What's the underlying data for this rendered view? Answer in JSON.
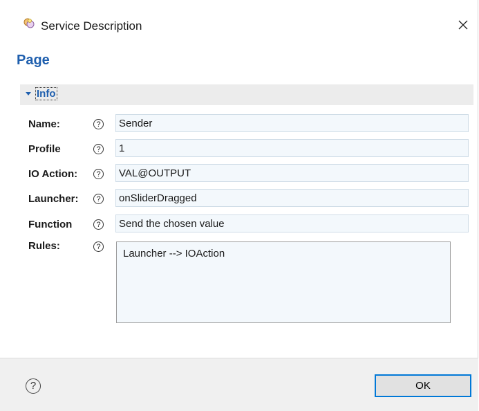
{
  "window": {
    "title": "Service Description",
    "close_glyph": "×"
  },
  "page": {
    "title": "Page"
  },
  "section": {
    "title": "Info",
    "expanded": true
  },
  "form": {
    "help_glyph": "?",
    "name": {
      "label": "Name:",
      "value": "Sender"
    },
    "profile": {
      "label": "Profile",
      "value": "1"
    },
    "io_action": {
      "label": "IO Action:",
      "value": "VAL@OUTPUT"
    },
    "launcher": {
      "label": "Launcher:",
      "value": "onSliderDragged"
    },
    "function": {
      "label": "Function",
      "value": "Send the chosen value"
    },
    "rules": {
      "label": "Rules:",
      "value": "Launcher --> IOAction"
    }
  },
  "footer": {
    "help_glyph": "?",
    "ok_label": "OK"
  },
  "colors": {
    "accent": "#1f5fae",
    "field_bg": "#f3f8fc",
    "section_bg": "#ececec",
    "footer_bg": "#f0f0f0",
    "focus": "#0078d7"
  },
  "icons": {
    "app": "eclipse-app-icon",
    "close": "close-icon",
    "help": "help-icon",
    "twisty": "chevron-down-icon"
  }
}
